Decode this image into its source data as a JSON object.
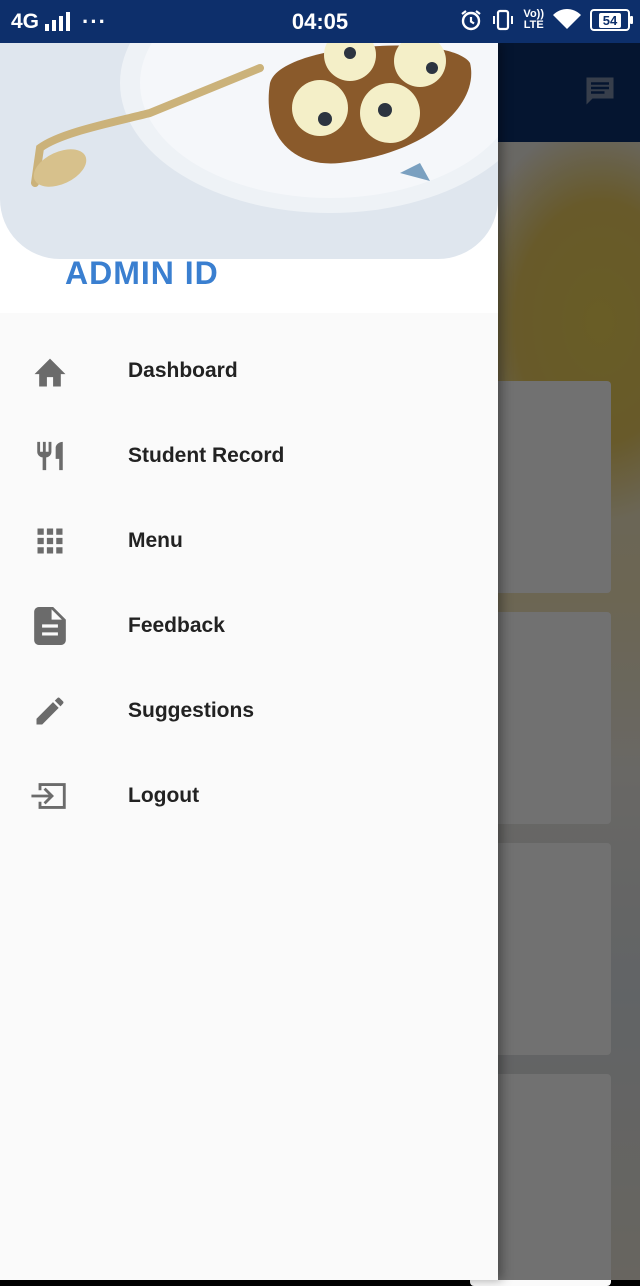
{
  "status_bar": {
    "network": "4G",
    "time": "04:05",
    "lte_top": "Vo))",
    "lte_bottom": "LTE",
    "battery": "54"
  },
  "drawer": {
    "header_title": "ADMIN ID",
    "items": [
      {
        "label": "Dashboard",
        "icon": "home-icon"
      },
      {
        "label": "Student Record",
        "icon": "fork-knife-icon"
      },
      {
        "label": "Menu",
        "icon": "grid-icon"
      },
      {
        "label": "Feedback",
        "icon": "document-icon"
      },
      {
        "label": "Suggestions",
        "icon": "pencil-icon"
      },
      {
        "label": "Logout",
        "icon": "logout-icon"
      }
    ]
  },
  "colors": {
    "app_bar": "#0d2f6b",
    "header_text": "#3a7fd0",
    "drawer_bg": "#fafafa",
    "icon": "#6b6b6b"
  }
}
